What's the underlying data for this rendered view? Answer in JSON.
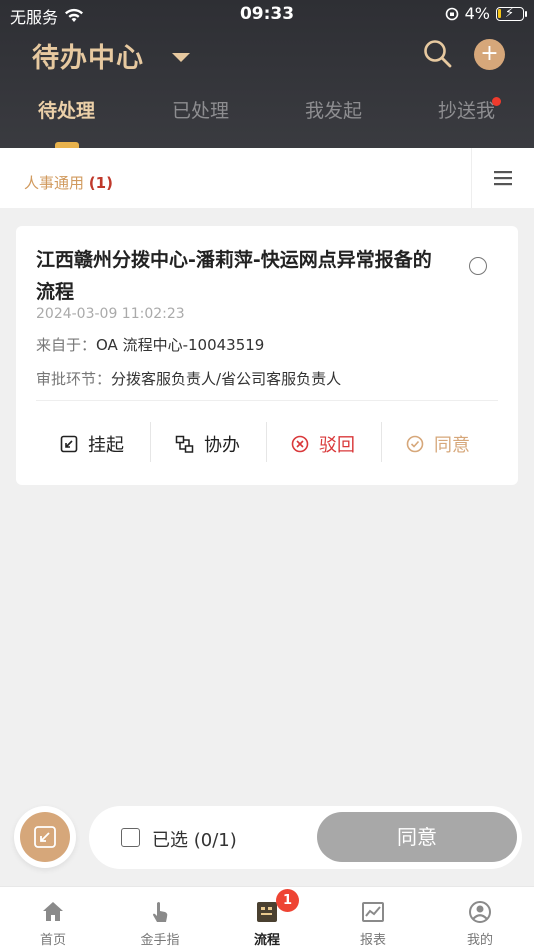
{
  "status_bar": {
    "carrier": "无服务",
    "time": "09:33",
    "battery": "4%"
  },
  "header": {
    "title": "待办中心"
  },
  "tabs": [
    {
      "label": "待处理",
      "active": true
    },
    {
      "label": "已处理",
      "active": false
    },
    {
      "label": "我发起",
      "active": false
    },
    {
      "label": "抄送我",
      "active": false,
      "dot": true
    }
  ],
  "category": {
    "label": "人事通用",
    "count": "(1)"
  },
  "card": {
    "title": "江西赣州分拨中心-潘莉萍-快运网点异常报备的流程",
    "date": "2024-03-09 11:02:23",
    "source_label": "来自于：",
    "source_value": "OA 流程中心-10043519",
    "node_label": "审批环节：",
    "node_value": "分拨客服负责人/省公司客服负责人",
    "actions": [
      {
        "label": "挂起",
        "icon": "suspend-icon",
        "color": "#222222"
      },
      {
        "label": "协办",
        "icon": "assist-icon",
        "color": "#222222"
      },
      {
        "label": "驳回",
        "icon": "reject-icon",
        "color": "#d9383a"
      },
      {
        "label": "同意",
        "icon": "approve-icon",
        "color": "#d6a77a"
      }
    ]
  },
  "bottom_bar": {
    "selected_text": "已选 (0/1)",
    "agree_label": "同意"
  },
  "bottom_nav": [
    {
      "label": "首页",
      "icon": "home-icon",
      "active": false
    },
    {
      "label": "金手指",
      "icon": "finger-icon",
      "active": false
    },
    {
      "label": "流程",
      "icon": "process-icon",
      "active": true,
      "badge": "1"
    },
    {
      "label": "报表",
      "icon": "report-icon",
      "active": false
    },
    {
      "label": "我的",
      "icon": "profile-icon",
      "active": false
    }
  ],
  "colors": {
    "accent": "#d6a77a",
    "header_bg": "#2e2f34",
    "reject": "#d9383a",
    "badge": "#ee4433"
  }
}
